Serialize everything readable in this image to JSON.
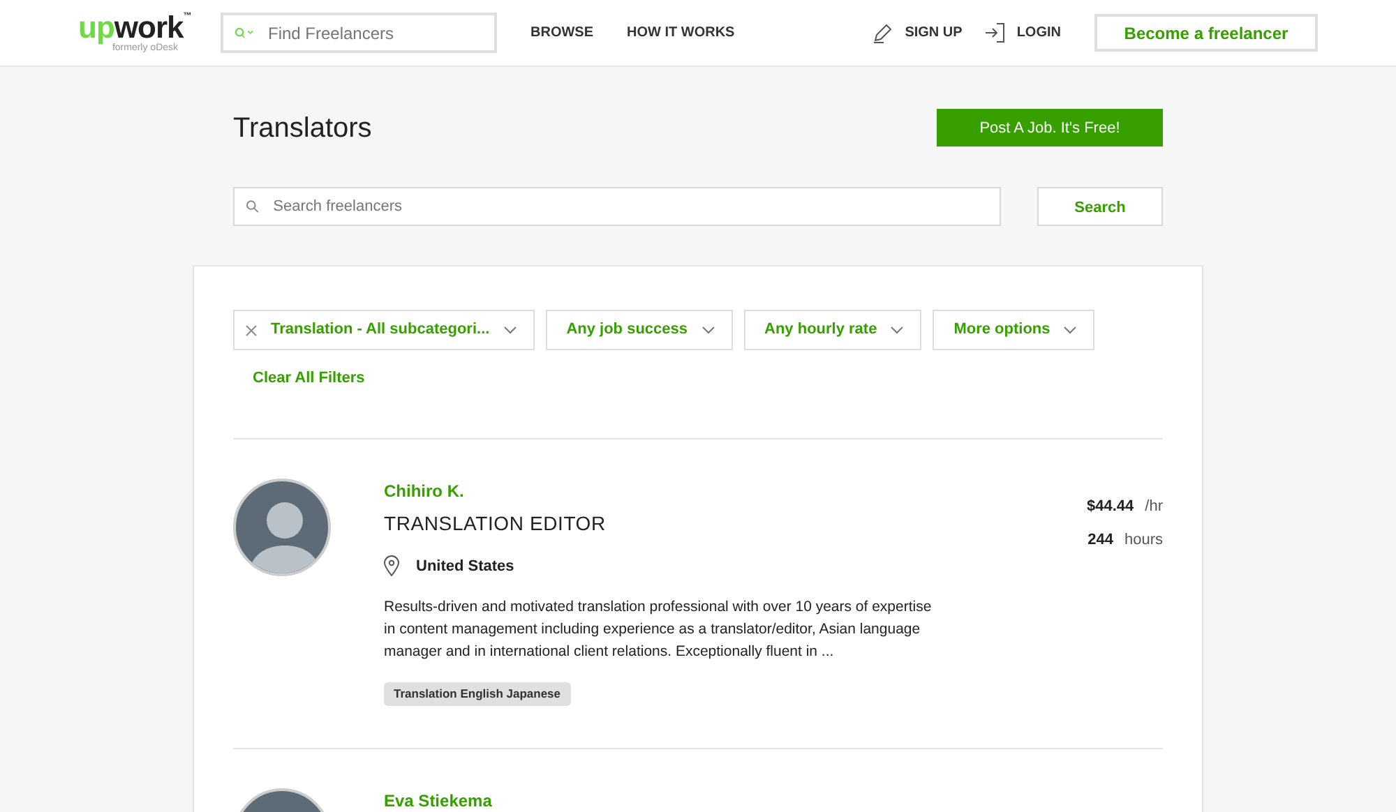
{
  "header": {
    "logo": {
      "accent": "up",
      "rest": "work",
      "tm": "™",
      "tagline": "formerly oDesk"
    },
    "search": {
      "placeholder": "Find Freelancers"
    },
    "nav": [
      "BROWSE",
      "HOW IT WORKS"
    ],
    "sign_up": "SIGN UP",
    "login": "LOGIN",
    "cta": "Become a freelancer"
  },
  "page": {
    "title": "Translators",
    "post_job": "Post A Job. It's Free!",
    "search": {
      "placeholder": "Search freelancers",
      "button": "Search"
    }
  },
  "filters": [
    {
      "label": "Translation - All subcategori...",
      "removable": true
    },
    {
      "label": "Any job success",
      "removable": false
    },
    {
      "label": "Any hourly rate",
      "removable": false
    },
    {
      "label": "More options",
      "removable": false
    }
  ],
  "clear_filters": "Clear All Filters",
  "freelancers": [
    {
      "name": "Chihiro K.",
      "title": "TRANSLATION EDITOR",
      "location": "United States",
      "rate": "$44.44",
      "rate_unit": "/hr",
      "hours": "244",
      "hours_unit": "hours",
      "description": "Results-driven and motivated translation professional with over 10 years of expertise in content management including experience as a translator/editor, Asian language manager and in international client relations. Exceptionally fluent in ...",
      "tags": [
        "Translation English Japanese"
      ]
    },
    {
      "name": "Eva Stiekema"
    }
  ]
}
